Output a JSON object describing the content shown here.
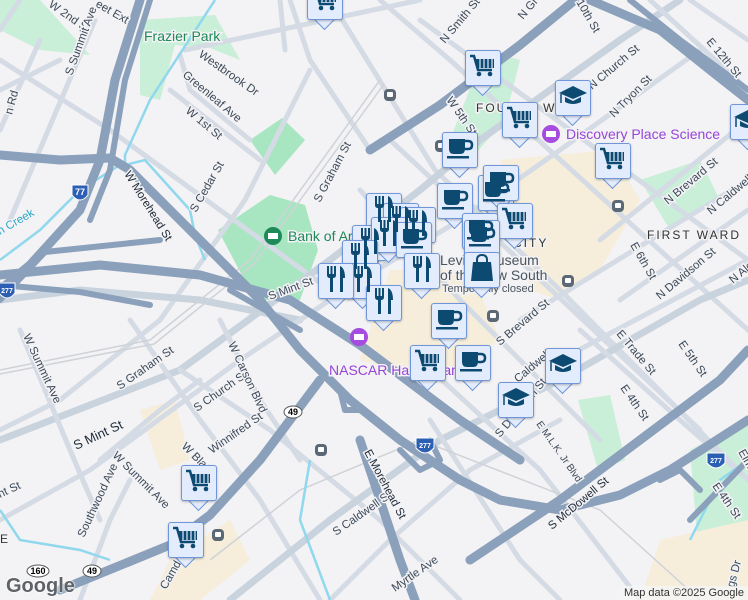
{
  "map": {
    "colors": {
      "background": "#f3f2f4",
      "highway": "#8aa0bb",
      "park": "#c9efd8",
      "downtown": "#f6eedb",
      "marker_fill": "#e3ecfc",
      "marker_border": "#6e96d8",
      "marker_icon": "#0d4a72"
    },
    "streets": {
      "w_2nd": "W 2nd St",
      "summit_n": "S Summit Ave",
      "street_ext": "eet Ext",
      "rd": "n Rd",
      "westbrook": "Westbrook Dr",
      "greenleaf": "Greenleaf Ave",
      "w1st": "W 1st St",
      "w_morehead": "W Morehead St",
      "cedar": "S Cedar St",
      "s_graham_n": "S Graham St",
      "s_mint_n": "S Mint St",
      "creek": "n Creek",
      "n_smith": "N Smith St",
      "n_graham": "N Gr",
      "tenth": "10th St",
      "church_n": "N Church St",
      "tryon": "N Tryon St",
      "e12th": "E 12th St",
      "w5th": "W 5th St",
      "n_brevard": "N Brevard St",
      "n_caldwell": "N Caldwell",
      "e6th": "E 6th St",
      "n_davidson": "N Davidson St",
      "n_alex": "N Alex",
      "w_summit": "W Summit Ave",
      "s_graham_s": "S Graham St",
      "s_church": "S Church St",
      "w_carson": "W Carson Blvd",
      "s_mint_s": "S Mint St",
      "winnifred": "Winnifred St",
      "w_bland": "W Bla",
      "w_summit2": "W Summit Ave",
      "southwood": "Southwood Ave",
      "mint_st2": "nt St",
      "camden": "Camde",
      "s_caldwell_s": "S Caldwell St",
      "e_morehead": "E Morehead St",
      "myrtle": "Myrtle Ave",
      "s_brevard": "S Brevard St",
      "caldwell": "Caldwell",
      "s_davidson": "S Davidson St",
      "mlk": "E M.L.K. Jr Blvd",
      "e_trade": "E Trade St",
      "e5th": "E 5th St",
      "e4th": "E 4th St",
      "e4th2": "E 4th St",
      "mcdowell": "S McDowell St",
      "elm": "Elm",
      "kings": "gs Dr"
    },
    "neighborhoods": {
      "fourth_ward": "FOURTH WARD",
      "first_ward": "FIRST WARD",
      "city": "CITY",
      "uptown_e": "E"
    },
    "pois": {
      "frazier": "Frazier Park",
      "bank": "Bank of Ar",
      "discovery": "Discovery Place Science",
      "nascar": "NASCAR Hall of Fame",
      "levine_1": "Levine Museum",
      "levine_2": "of the New South",
      "levine_3": "Temporarily closed"
    },
    "shields": {
      "i77": "77",
      "i277a": "277",
      "i277b": "277",
      "i277c": "277",
      "nc49a": "49",
      "nc49b": "49",
      "nc160": "160"
    },
    "markers": [
      "cart",
      "cart",
      "graduation-cap",
      "cart",
      "coffee",
      "cart",
      "graduation-cap",
      "restaurant",
      "restaurant",
      "restaurant",
      "coffee",
      "coffee",
      "coffee",
      "cart",
      "restaurant",
      "restaurant",
      "coffee",
      "coffee",
      "coffee",
      "restaurant",
      "restaurant",
      "restaurant",
      "shopping-bag",
      "restaurant",
      "restaurant",
      "coffee",
      "cart",
      "coffee",
      "graduation-cap",
      "graduation-cap",
      "cart",
      "cart"
    ],
    "attribution": "Map data ©2025 Google",
    "logo": "Google"
  }
}
